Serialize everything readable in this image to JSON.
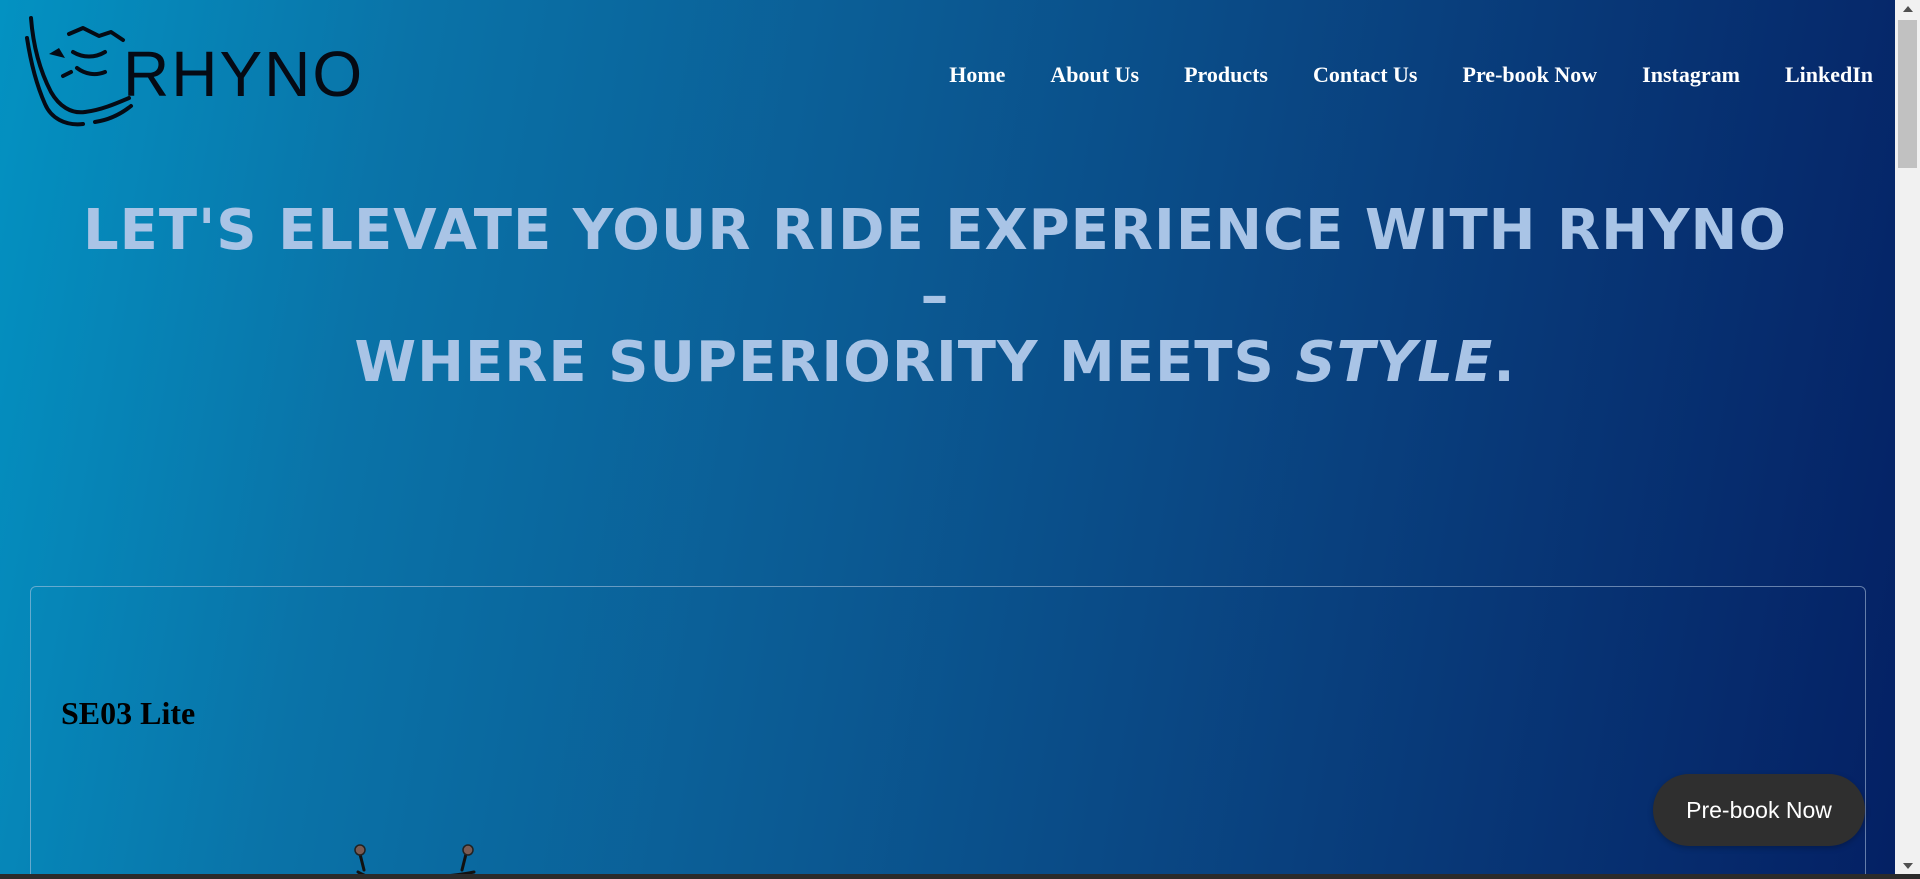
{
  "brand": {
    "name": "RHYNO",
    "logo_icon": "rhino-head-icon"
  },
  "nav": {
    "items": [
      {
        "label": "Home"
      },
      {
        "label": "About Us"
      },
      {
        "label": "Products"
      },
      {
        "label": "Contact Us"
      },
      {
        "label": "Pre-book Now"
      },
      {
        "label": "Instagram"
      },
      {
        "label": "LinkedIn"
      }
    ]
  },
  "hero": {
    "line1": "LET'S ELEVATE YOUR RIDE EXPERIENCE WITH RHYNO –",
    "line2_prefix": "WHERE SUPERIORITY MEETS ",
    "line2_emphasis": "STYLE",
    "line2_suffix": "."
  },
  "product": {
    "title": "SE03 Lite",
    "image_icon": "scooter-handlebar-icon"
  },
  "floating_button": {
    "label": "Pre-book Now"
  },
  "colors": {
    "gradient_start": "#0392c2",
    "gradient_end": "#041f63",
    "hero_text": "#a9c4e6",
    "nav_text": "#ffffff",
    "button_bg": "#2f2f2f"
  }
}
